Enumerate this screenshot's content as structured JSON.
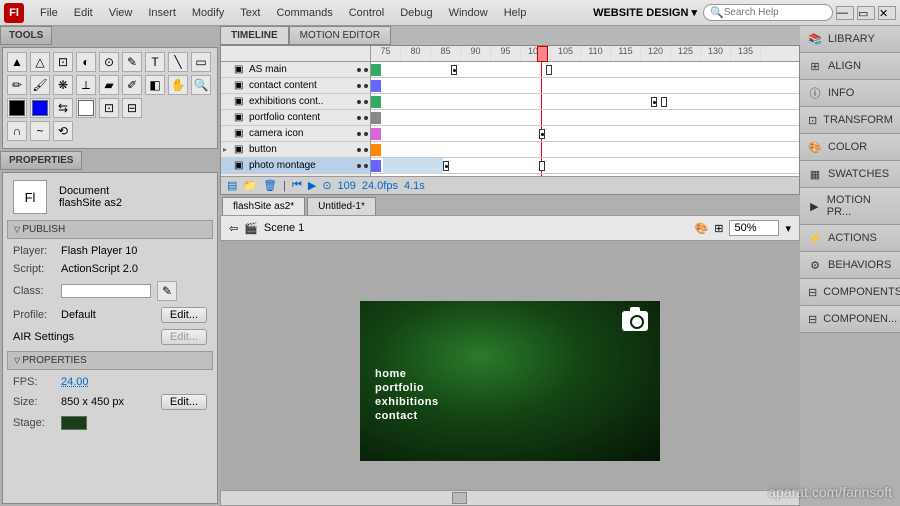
{
  "menubar": {
    "items": [
      "File",
      "Edit",
      "View",
      "Insert",
      "Modify",
      "Text",
      "Commands",
      "Control",
      "Debug",
      "Window",
      "Help"
    ],
    "workspace": "WEBSITE DESIGN",
    "search_placeholder": "Search Help"
  },
  "panels": {
    "tools": "TOOLS",
    "properties": "PROPERTIES"
  },
  "document": {
    "type": "Document",
    "name": "flashSite as2"
  },
  "publish": {
    "title": "PUBLISH",
    "player_label": "Player:",
    "player_value": "Flash Player 10",
    "script_label": "Script:",
    "script_value": "ActionScript 2.0",
    "class_label": "Class:",
    "class_value": "",
    "profile_label": "Profile:",
    "profile_value": "Default",
    "air_label": "AIR Settings",
    "edit_btn": "Edit..."
  },
  "propsect": {
    "title": "PROPERTIES",
    "fps_label": "FPS:",
    "fps_value": "24.00",
    "size_label": "Size:",
    "size_value": "850 x 450 px",
    "stage_label": "Stage:",
    "edit_btn": "Edit..."
  },
  "timeline": {
    "tabs": [
      "TIMELINE",
      "MOTION EDITOR"
    ],
    "ticks": [
      "75",
      "80",
      "85",
      "90",
      "95",
      "100",
      "105",
      "110",
      "115",
      "120",
      "125",
      "130",
      "135"
    ],
    "layers": [
      {
        "name": "AS main",
        "color": "#3a6"
      },
      {
        "name": "contact content",
        "color": "#66f"
      },
      {
        "name": "exhibitions cont..",
        "color": "#3a6"
      },
      {
        "name": "portfolio content",
        "color": "#888"
      },
      {
        "name": "camera icon",
        "color": "#d6d"
      },
      {
        "name": "button",
        "color": "#f80"
      },
      {
        "name": "photo montage",
        "color": "#66f"
      },
      {
        "name": "",
        "color": "#3a6"
      }
    ],
    "footer": {
      "frame": "109",
      "fps": "24.0fps",
      "time": "4.1s"
    }
  },
  "doctabs": [
    "flashSite as2*",
    "Untitled-1*"
  ],
  "scene": {
    "label": "Scene 1",
    "zoom": "50%"
  },
  "stage_menu": [
    "home",
    "portfolio",
    "exhibitions",
    "contact"
  ],
  "right_panels": [
    "LIBRARY",
    "ALIGN",
    "INFO",
    "TRANSFORM",
    "COLOR",
    "SWATCHES",
    "MOTION PR...",
    "ACTIONS",
    "BEHAVIORS",
    "COMPONENTS",
    "COMPONEN..."
  ],
  "right_icons": [
    "📚",
    "⊞",
    "ⓘ",
    "⊡",
    "🎨",
    "▦",
    "▶",
    "⚡",
    "⚙",
    "⊟",
    "⊟"
  ],
  "watermark": "aparat.com/farinsoft"
}
